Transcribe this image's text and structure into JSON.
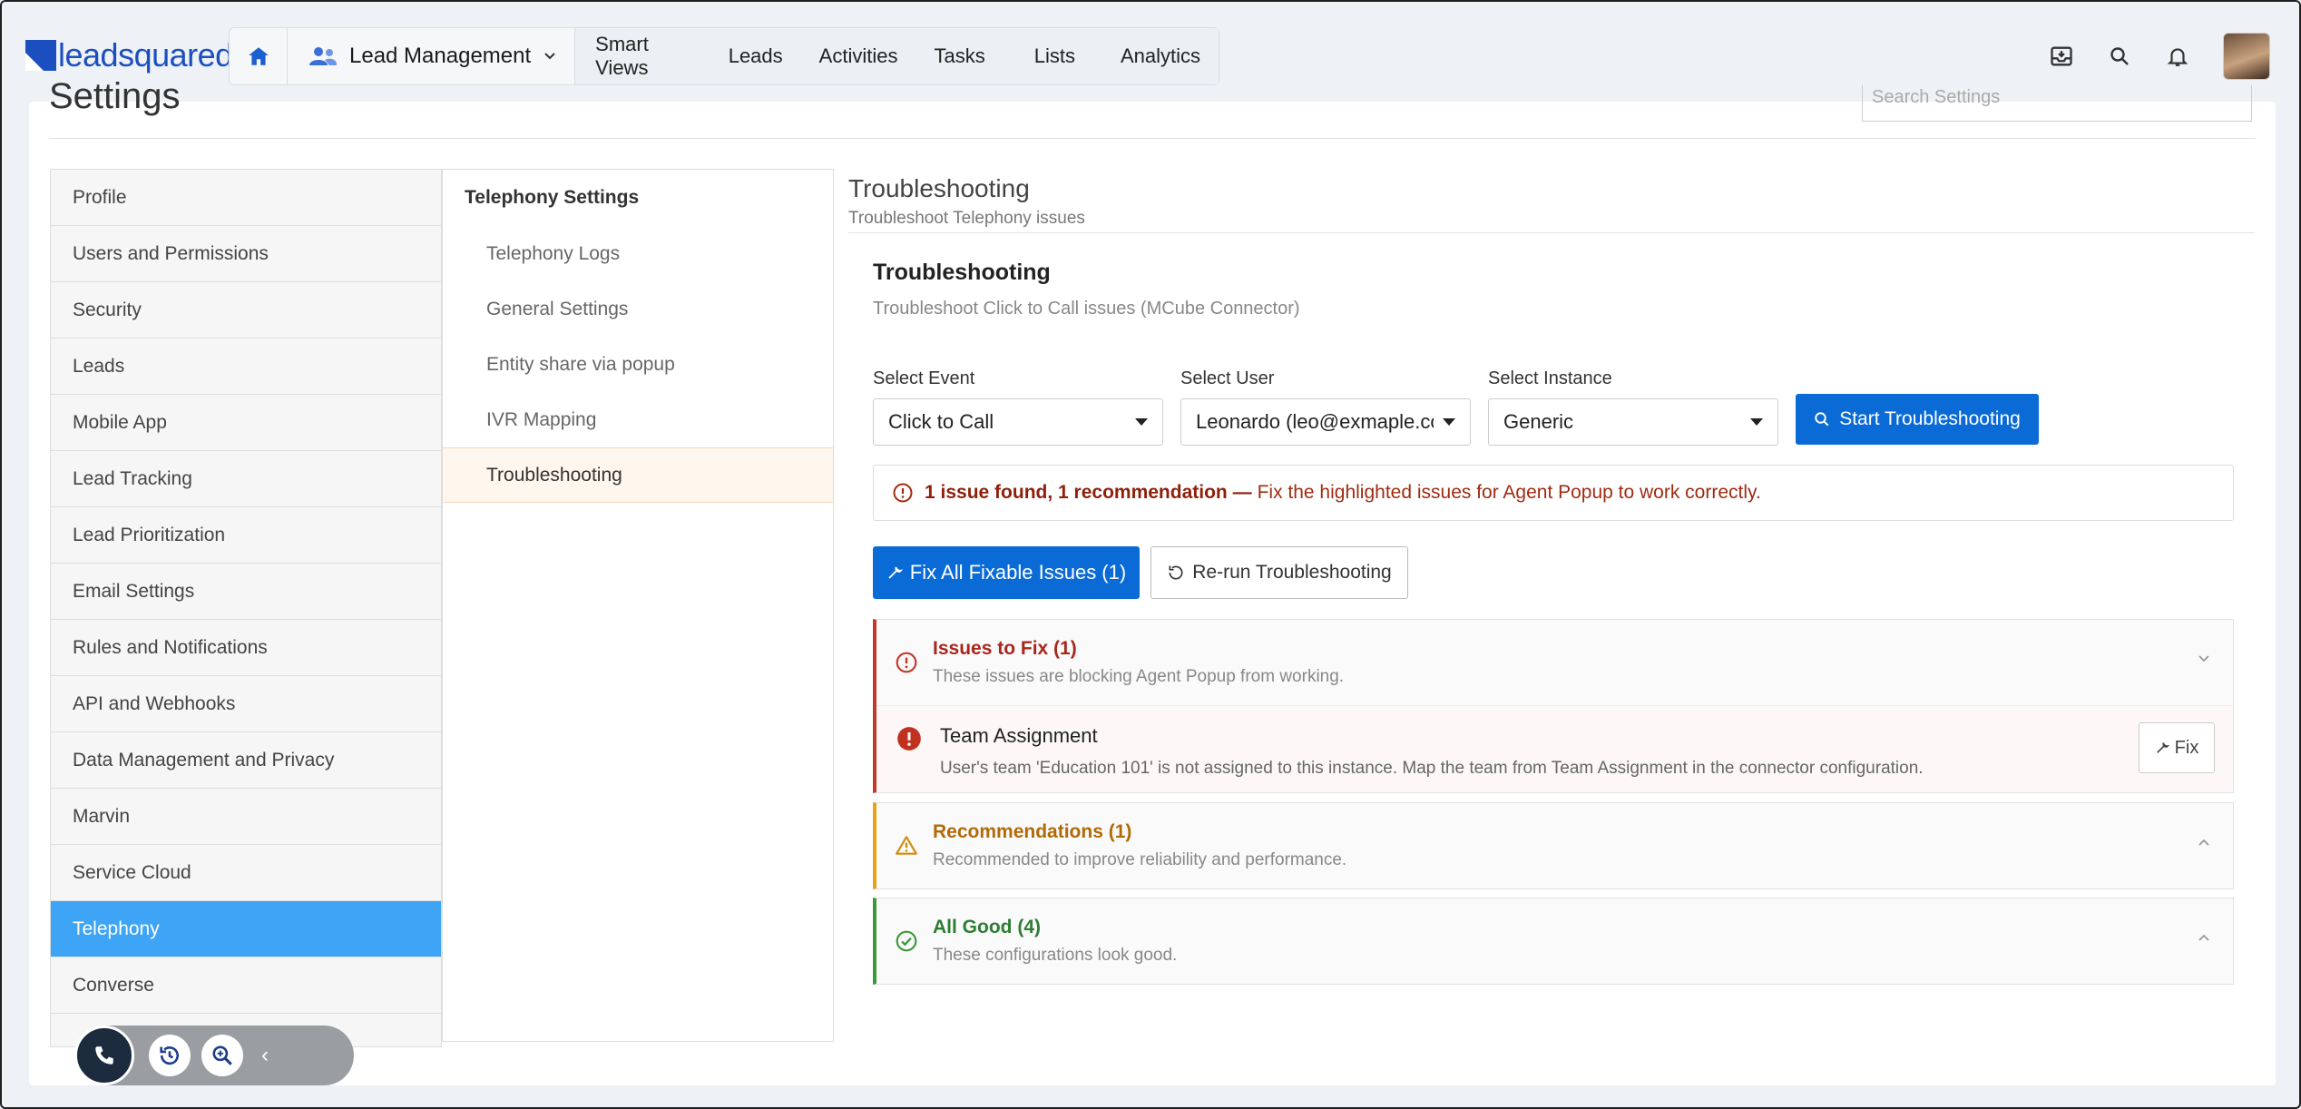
{
  "brand": {
    "logo_text": "leadsquared"
  },
  "topnav": {
    "app_label": "Lead Management",
    "tabs": [
      "Smart Views",
      "Leads",
      "Activities",
      "Tasks",
      "Lists",
      "Analytics"
    ]
  },
  "page": {
    "title": "Settings",
    "search_placeholder": "Search Settings"
  },
  "sidebar": {
    "items": [
      "Profile",
      "Users and Permissions",
      "Security",
      "Leads",
      "Mobile App",
      "Lead Tracking",
      "Lead Prioritization",
      "Email Settings",
      "Rules and Notifications",
      "API and Webhooks",
      "Data Management and Privacy",
      "Marvin",
      "Service Cloud",
      "Telephony",
      "Converse"
    ],
    "active": "Telephony"
  },
  "submenu": {
    "header": "Telephony Settings",
    "items": [
      "Telephony Logs",
      "General Settings",
      "Entity share via popup",
      "IVR Mapping",
      "Troubleshooting"
    ],
    "active": "Troubleshooting"
  },
  "main": {
    "title": "Troubleshooting",
    "subtitle": "Troubleshoot Telephony issues",
    "inner_title": "Troubleshooting",
    "inner_subtitle": "Troubleshoot Click to Call issues (MCube Connector)",
    "fields": {
      "event": {
        "label": "Select Event",
        "value": "Click to Call"
      },
      "user": {
        "label": "Select User",
        "value": "Leonardo (leo@exmaple.com)"
      },
      "instance": {
        "label": "Select Instance",
        "value": "Generic"
      }
    },
    "start_button": "Start Troubleshooting",
    "alert": {
      "bold": "1 issue found, 1 recommendation —",
      "text": "Fix the highlighted issues for Agent Popup to work correctly."
    },
    "fix_all_button": "Fix All Fixable Issues (1)",
    "rerun_button": "Re-run Troubleshooting",
    "groups": {
      "issues": {
        "title": "Issues to Fix (1)",
        "subtitle": "These issues are blocking Agent Popup from working.",
        "color": "#c0392b"
      },
      "recommendations": {
        "title": "Recommendations (1)",
        "subtitle": "Recommended to improve reliability and performance.",
        "color": "#d48a0c"
      },
      "good": {
        "title": "All Good (4)",
        "subtitle": "These configurations look good.",
        "color": "#3a9a3a"
      }
    },
    "issue_item": {
      "title": "Team Assignment",
      "desc": "User's team 'Education 101' is not assigned to this instance. Map the team from Team Assignment in the connector configuration.",
      "fix_button": "Fix"
    }
  },
  "colors": {
    "primary": "#0b6bd6",
    "active_sidebar": "#3da4f6",
    "brand": "#1b4fbf"
  }
}
